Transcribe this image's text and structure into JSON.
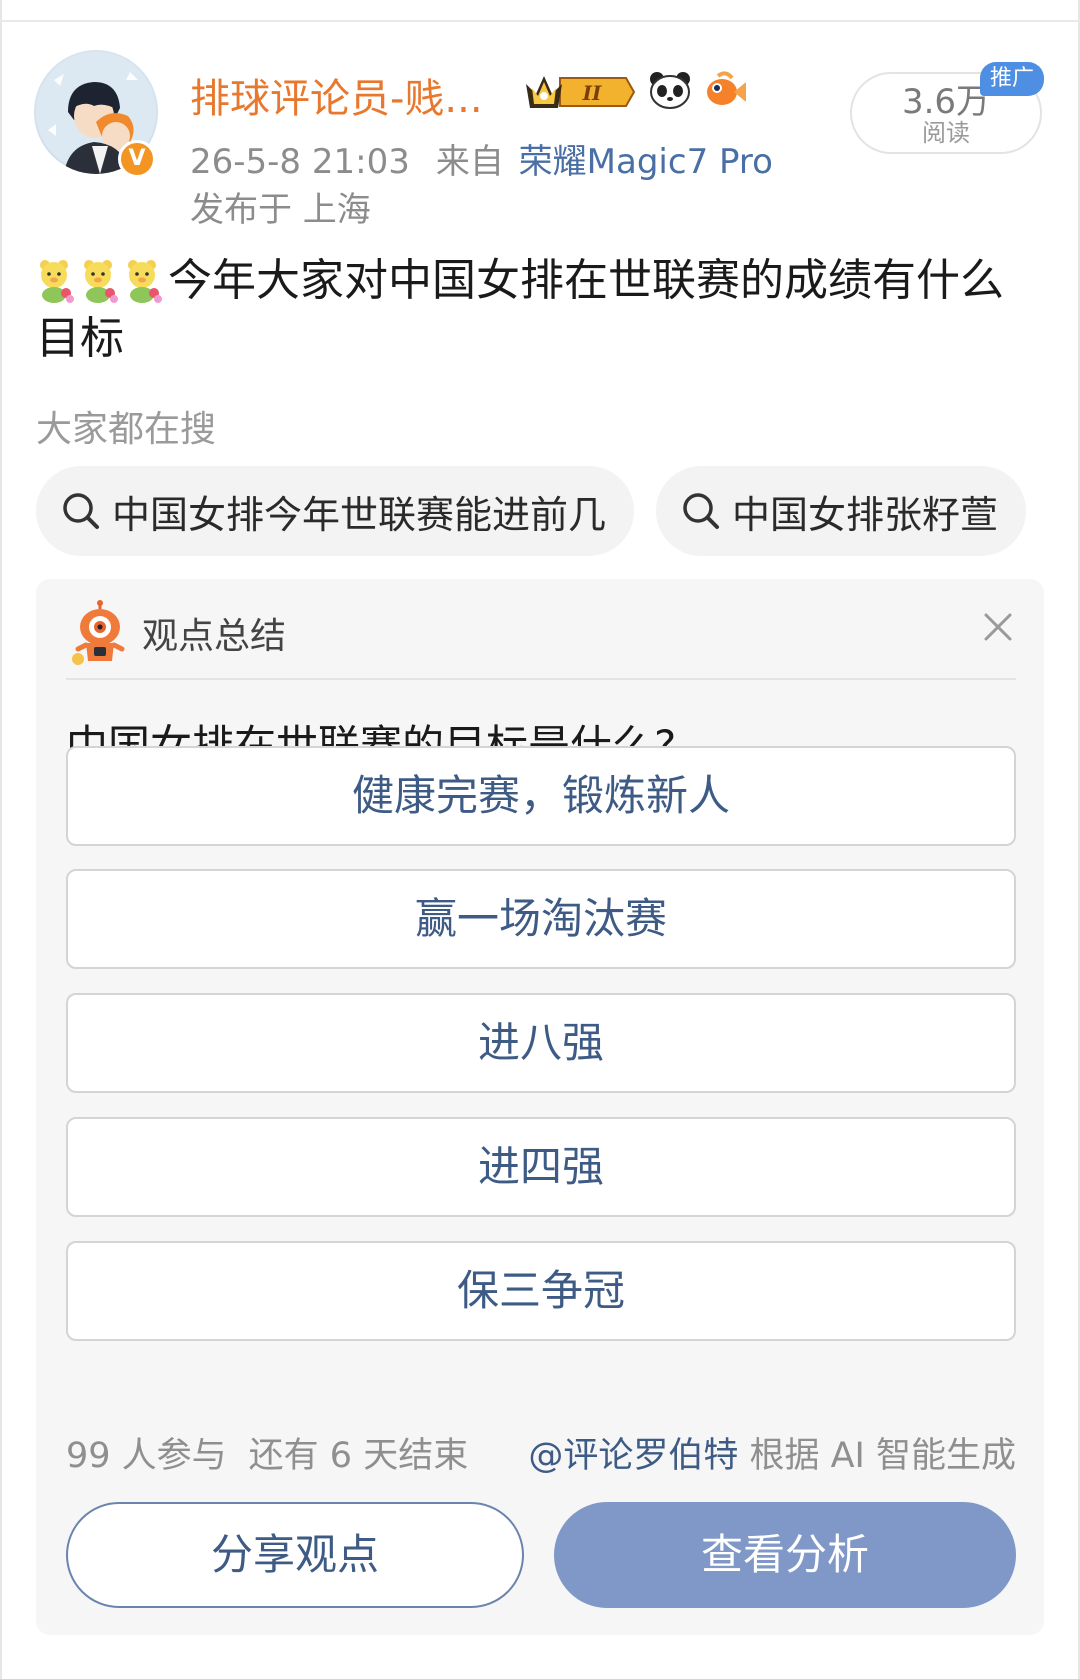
{
  "post": {
    "username": "排球评论员-贱...",
    "timestamp": "26-5-8 21:03",
    "source_prefix": "来自",
    "device": "荣耀Magic7 Pro",
    "location": "发布于 上海",
    "reads_count": "3.6万",
    "reads_label": "阅读",
    "promo_tag": "推广",
    "verified_badge": "V",
    "crown_badge_text": "II",
    "badge_icons": [
      "crown-badge-icon",
      "panda-icon",
      "goldfish-icon"
    ],
    "emoji_icons": [
      "bear-flower-emoji",
      "bear-flower-emoji",
      "bear-flower-emoji"
    ],
    "text": "今年大家对中国女排在世联赛的成绩有什么目标"
  },
  "search": {
    "label": "大家都在搜",
    "chips": [
      {
        "text": "中国女排今年世联赛能进前几"
      },
      {
        "text": "中国女排张籽萱"
      }
    ]
  },
  "opinion_card": {
    "title": "观点总结",
    "question": "中国女排在世联赛的目标是什么?",
    "options": [
      {
        "label": "健康完赛，锻炼新人"
      },
      {
        "label": "赢一场淘汰赛"
      },
      {
        "label": "进八强"
      },
      {
        "label": "进四强"
      },
      {
        "label": "保三争冠"
      }
    ],
    "participants": "99 人参与",
    "time_left": "还有 6 天结束",
    "credit_mention": "@评论罗伯特",
    "credit_suffix": " 根据 AI 智能生成",
    "share_button": "分享观点",
    "analyze_button": "查看分析"
  },
  "colors": {
    "username": "#e8782e",
    "link_blue": "#3d5b84",
    "analyze_button_bg": "#7f98c7",
    "card_bg": "#f6f6f6",
    "verified_orange": "#f39523",
    "promo_blue": "#4e8fe3"
  }
}
